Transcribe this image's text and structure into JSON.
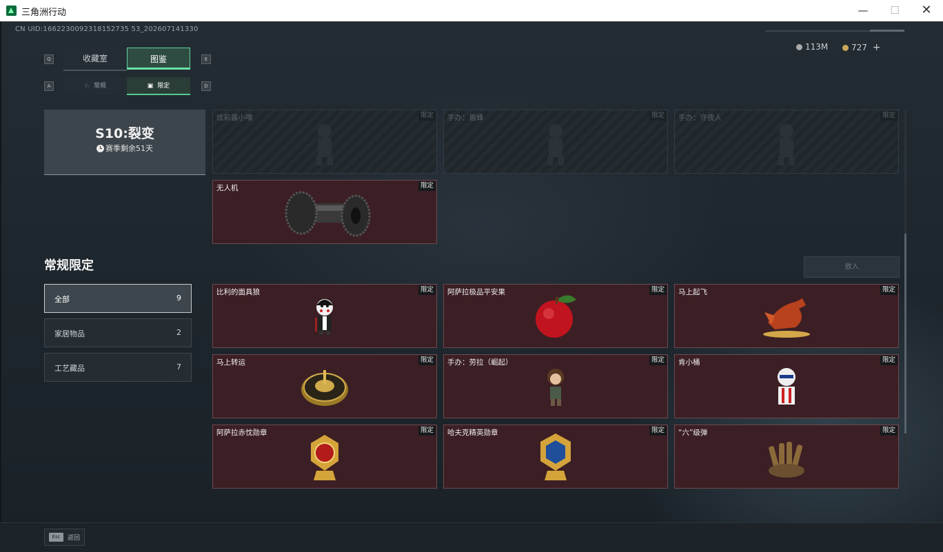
{
  "window": {
    "title": "三角洲行动",
    "minimize": "—",
    "maximize": "☐",
    "close": "✕"
  },
  "header": {
    "uid": "CN UID:1662230092318152735 53_202607141330",
    "key_left": "Q",
    "key_right": "E",
    "key_sub_left": "A",
    "key_sub_right": "D",
    "tabs": [
      "收藏室",
      "图鉴"
    ],
    "subtabs": [
      "常规",
      "限定"
    ],
    "currency": {
      "coin_a": "113M",
      "coin_b": "727",
      "add": "+"
    }
  },
  "season": {
    "title": "S10:裂变",
    "remaining": "赛季剩余51天"
  },
  "season_items": [
    {
      "name": "炫彩露小嘿",
      "badge": "限定",
      "locked": true,
      "icon": "figure-silhouette"
    },
    {
      "name": "手办：盾蜂",
      "badge": "限定",
      "locked": true,
      "icon": "figure-silhouette"
    },
    {
      "name": "手办：守夜人",
      "badge": "限定",
      "locked": true,
      "icon": "figure-silhouette"
    },
    {
      "name": "无人机",
      "badge": "限定",
      "locked": false,
      "icon": "drone-roller-icon"
    }
  ],
  "regular": {
    "title": "常规限定",
    "put_in": "放入",
    "filters": [
      {
        "label": "全部",
        "count": "9",
        "active": true
      },
      {
        "label": "家居物品",
        "count": "2",
        "active": false
      },
      {
        "label": "工艺藏品",
        "count": "7",
        "active": false
      }
    ],
    "items": [
      {
        "name": "比利的面具狼",
        "badge": "限定",
        "icon": "puppet-figure-icon"
      },
      {
        "name": "阿萨拉极品平安果",
        "badge": "限定",
        "icon": "apple-icon"
      },
      {
        "name": "马上起飞",
        "badge": "限定",
        "icon": "horse-statue-icon"
      },
      {
        "name": "马上转运",
        "badge": "限定",
        "icon": "compass-plate-icon"
      },
      {
        "name": "手办：劳拉（崛起）",
        "badge": "限定",
        "icon": "explorer-figure-icon"
      },
      {
        "name": "肯小桶",
        "badge": "限定",
        "icon": "bucket-figure-icon"
      },
      {
        "name": "阿萨拉赤忱勋章",
        "badge": "限定",
        "icon": "red-medal-icon"
      },
      {
        "name": "哈夫克精英勋章",
        "badge": "限定",
        "icon": "blue-medal-icon"
      },
      {
        "name": "“六”级弹",
        "badge": "限定",
        "icon": "bullet-hand-icon"
      }
    ]
  },
  "footer": {
    "esc_key": "Esc",
    "esc_label": "返回"
  },
  "colors": {
    "accent": "#6ae3a8",
    "card_bg": "#3c1f24",
    "locked_bg": "#242c31"
  }
}
